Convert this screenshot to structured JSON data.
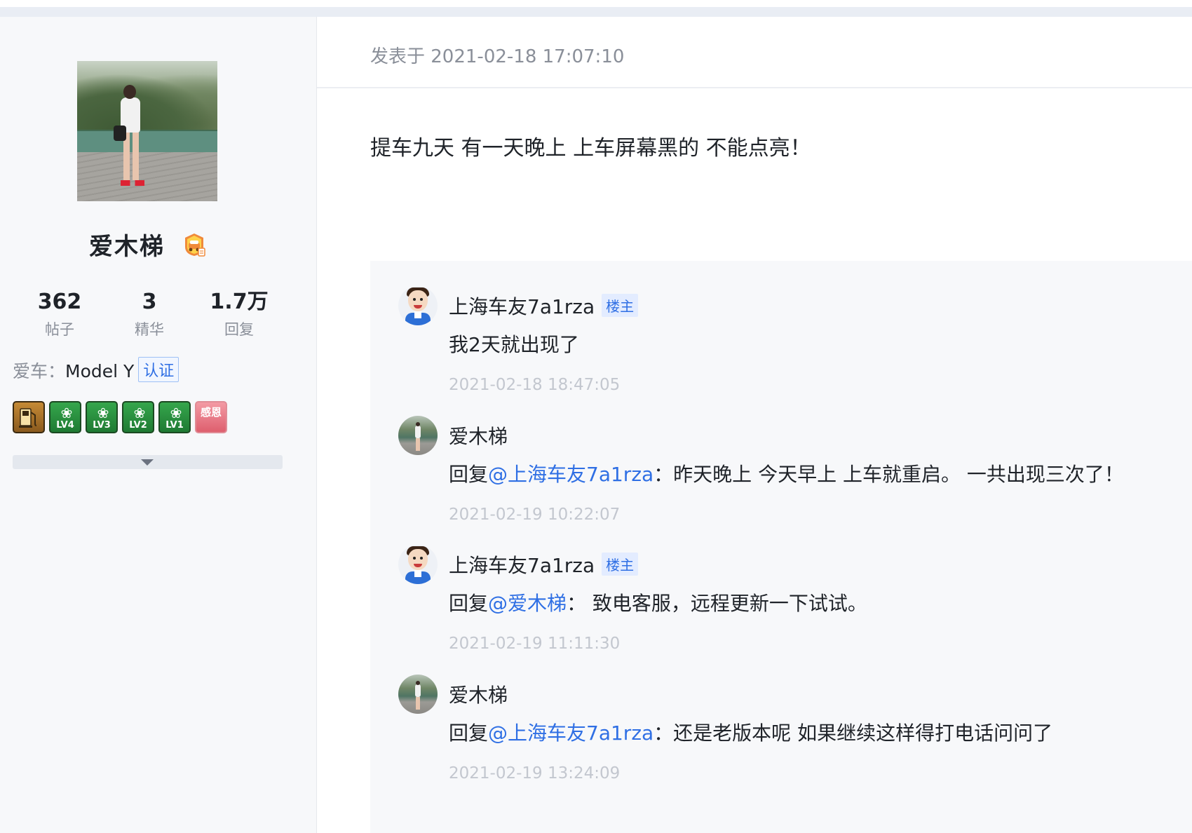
{
  "author": {
    "username": "爱木梯",
    "stats": [
      {
        "value": "362",
        "label": "帖子"
      },
      {
        "value": "3",
        "label": "精华"
      },
      {
        "value": "1.7万",
        "label": "回复"
      }
    ],
    "car_label": "爱车：",
    "car_model": "Model Y",
    "verify_label": "认证",
    "medals": [
      {
        "icon": "fuel-pump-medal-icon",
        "text": ""
      },
      {
        "icon": "flower-level-medal-icon",
        "text": "LV4"
      },
      {
        "icon": "flower-level-medal-icon",
        "text": "LV3"
      },
      {
        "icon": "flower-level-medal-icon",
        "text": "LV2"
      },
      {
        "icon": "flower-level-medal-icon",
        "text": "LV1"
      },
      {
        "icon": "heart-thanks-medal-icon",
        "text": "感恩"
      }
    ]
  },
  "post": {
    "meta": "发表于 2021-02-18 17:07:10",
    "content": "提车九天 有一天晚上 上车屏幕黑的 不能点亮！"
  },
  "replies": [
    {
      "avatar": "cartoon-avatar",
      "name": "上海车友7a1rza",
      "tag": "楼主",
      "prefix": "",
      "mention": "",
      "text": "我2天就出现了",
      "time": "2021-02-18 18:47:05"
    },
    {
      "avatar": "photo-avatar",
      "name": "爱木梯",
      "tag": "",
      "prefix": "回复",
      "mention": "@上海车友7a1rza",
      "text": "：昨天晚上 今天早上 上车就重启。 一共出现三次了！",
      "time": "2021-02-19 10:22:07"
    },
    {
      "avatar": "cartoon-avatar",
      "name": "上海车友7a1rza",
      "tag": "楼主",
      "prefix": "回复",
      "mention": "@爱木梯",
      "text": "：  致电客服，远程更新一下试试。",
      "time": "2021-02-19 11:11:30"
    },
    {
      "avatar": "photo-avatar",
      "name": "爱木梯",
      "tag": "",
      "prefix": "回复",
      "mention": "@上海车友7a1rza",
      "text": "：还是老版本呢 如果继续这样得打电话问问了",
      "time": "2021-02-19 13:24:09"
    }
  ],
  "colors": {
    "accent": "#2f6fe4",
    "text_primary": "#1f2329",
    "text_secondary": "#8a8f99",
    "sidebar_bg": "#f7f8fa"
  }
}
